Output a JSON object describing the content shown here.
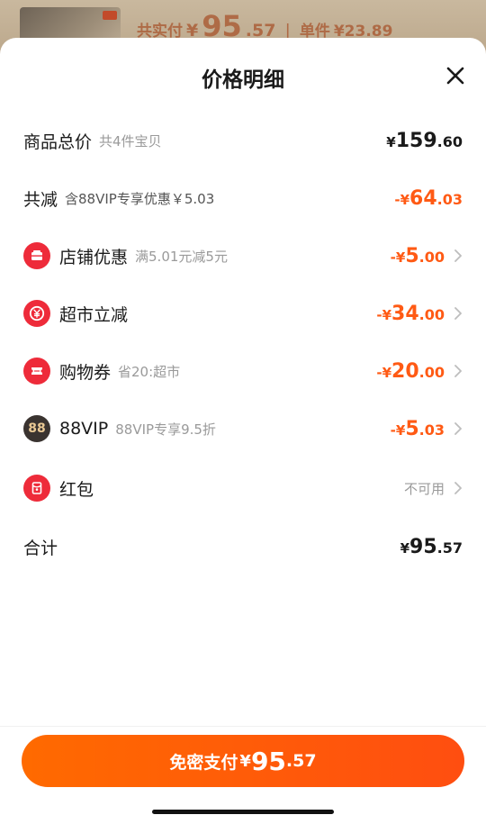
{
  "background": {
    "summary_total_label": "共实付",
    "summary_total_yen": "¥",
    "summary_total_int": "95",
    "summary_total_dec": ".57",
    "summary_sep": "|",
    "summary_unit_label": "单件",
    "summary_unit_value": "¥23.89"
  },
  "sheet": {
    "title": "价格明细"
  },
  "rows": {
    "goods_total": {
      "label": "商品总价",
      "sub": "共4件宝贝",
      "yen": "¥",
      "int": "159",
      "dec": ".60"
    },
    "total_reduce": {
      "label": "共减",
      "sub": "含88VIP专享优惠￥5.03",
      "yen": "-¥",
      "int": "64",
      "dec": ".03"
    },
    "shop_discount": {
      "label": "店铺优惠",
      "sub": "满5.01元减5元",
      "yen": "-¥",
      "int": "5",
      "dec": ".00",
      "icon": "shop-icon"
    },
    "supermarket": {
      "label": "超市立减",
      "sub": "",
      "yen": "-¥",
      "int": "34",
      "dec": ".00",
      "icon": "yen-coin-icon"
    },
    "coupon": {
      "label": "购物券",
      "sub": "省20:超市",
      "yen": "-¥",
      "int": "20",
      "dec": ".00",
      "icon": "ticket-icon"
    },
    "vip": {
      "label": "88VIP",
      "sub": "88VIP专享9.5折",
      "yen": "-¥",
      "int": "5",
      "dec": ".03",
      "icon_text": "88"
    },
    "red_packet": {
      "label": "红包",
      "status": "不可用",
      "icon": "red-packet-icon"
    },
    "sum": {
      "label": "合计",
      "yen": "¥",
      "int": "95",
      "dec": ".57"
    }
  },
  "pay_button": {
    "label": "免密支付",
    "yen": "¥",
    "int": "95",
    "dec": ".57"
  },
  "colors": {
    "accent_orange": "#ff5a14",
    "icon_red": "#ee2b3a",
    "button_start": "#ff6a00",
    "button_end": "#ff4e10"
  }
}
